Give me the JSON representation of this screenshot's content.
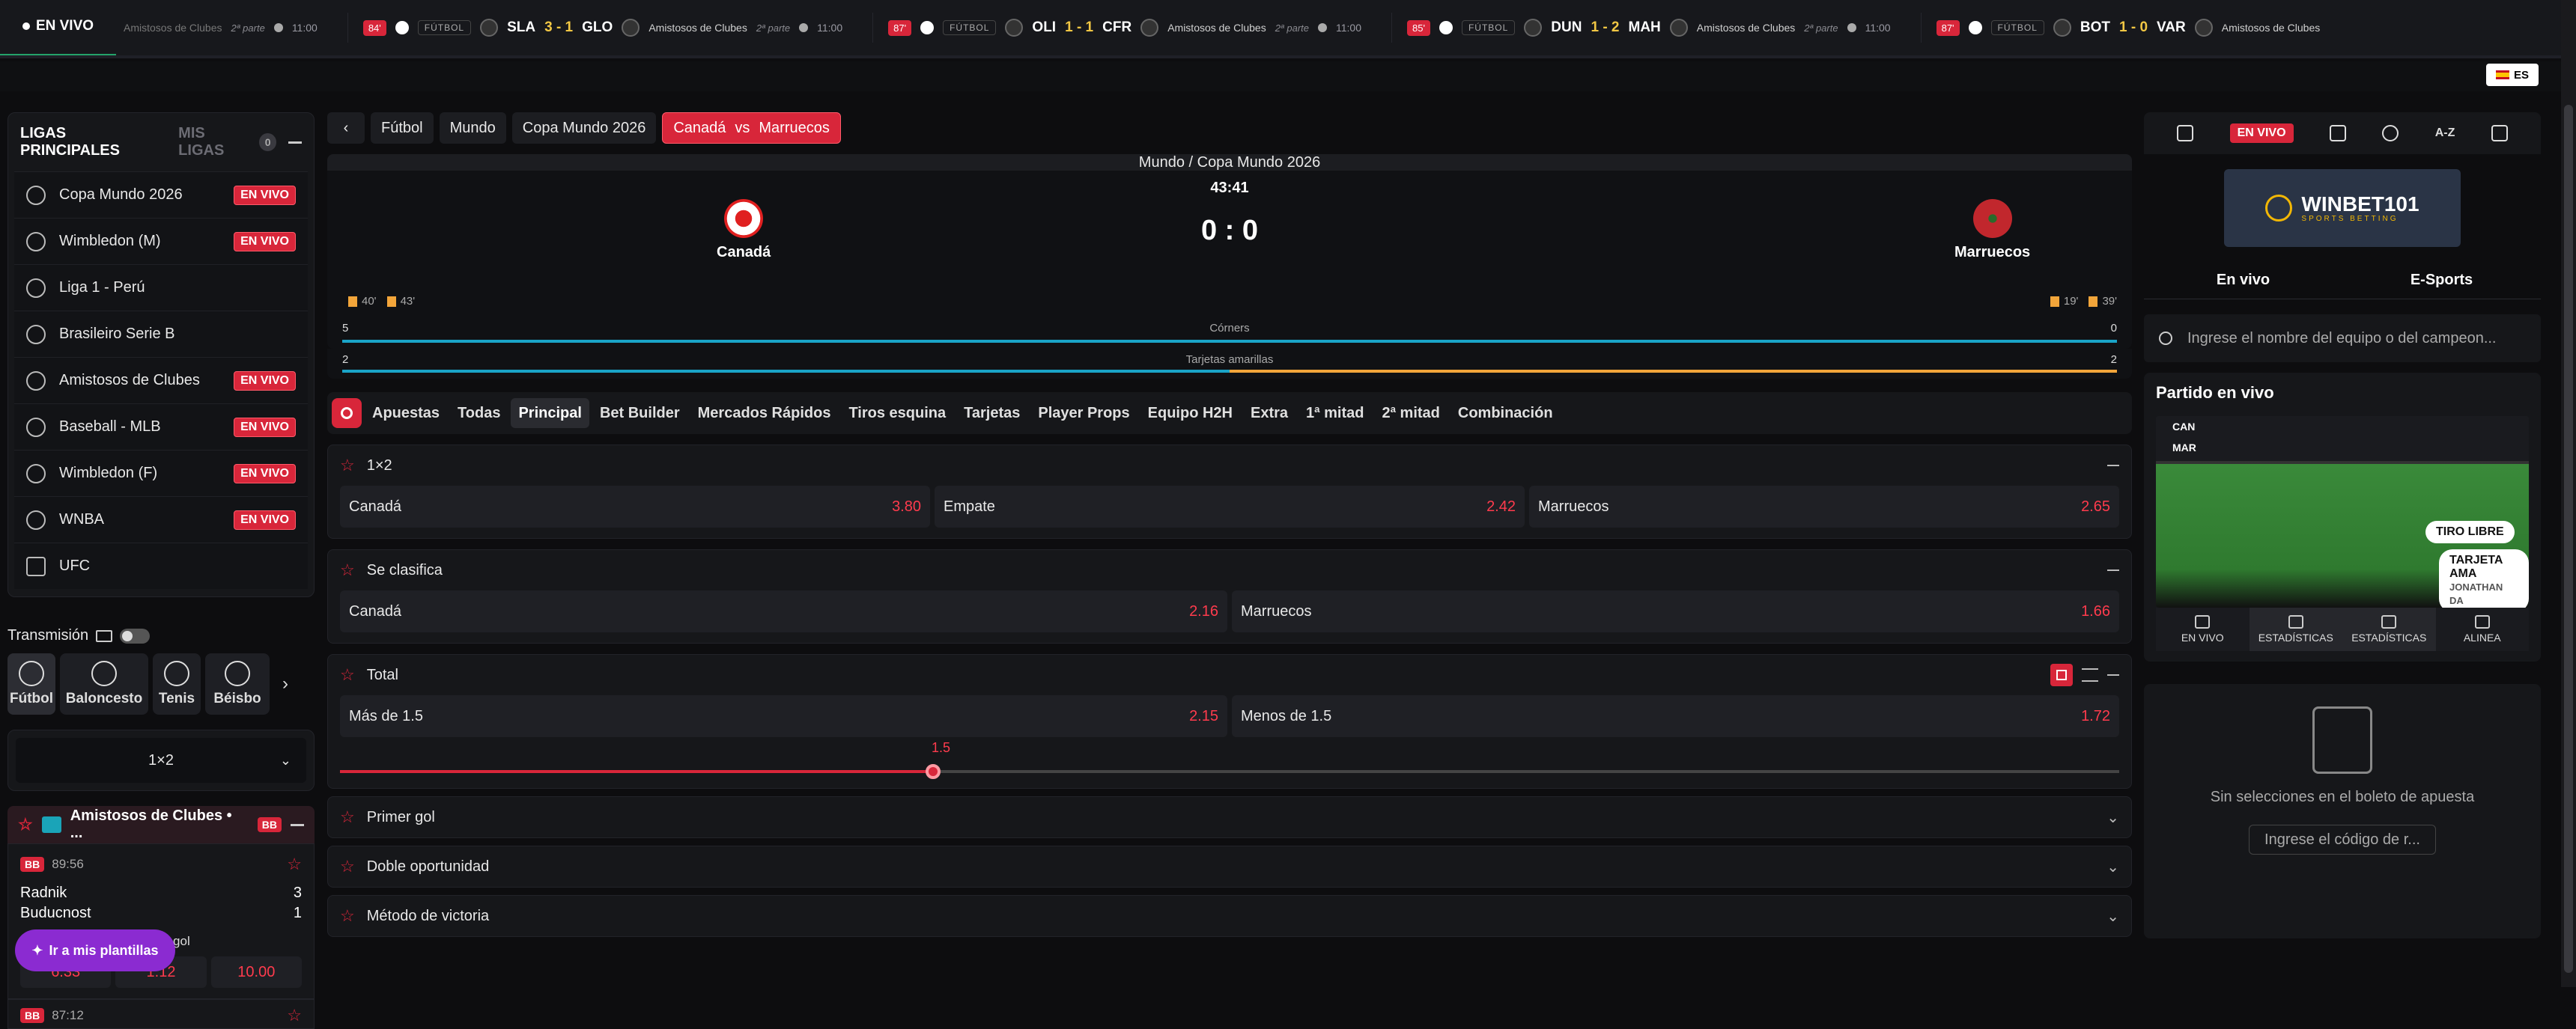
{
  "ticker": {
    "live_label": "EN VIVO",
    "items": [
      {
        "min": "",
        "sport": "",
        "home": "",
        "score": "",
        "away": "",
        "comp": "Amistosos de Clubes",
        "phase": "2ª parte",
        "time": "11:00"
      },
      {
        "min": "84'",
        "sport": "FÚTBOL",
        "home": "SLA",
        "score": "3 - 1",
        "away": "GLO",
        "comp": "Amistosos de Clubes",
        "phase": "2ª parte",
        "time": "11:00"
      },
      {
        "min": "87'",
        "sport": "FÚTBOL",
        "home": "OLI",
        "score": "1 - 1",
        "away": "CFR",
        "comp": "Amistosos de Clubes",
        "phase": "2ª parte",
        "time": "11:00"
      },
      {
        "min": "85'",
        "sport": "FÚTBOL",
        "home": "DUN",
        "score": "1 - 2",
        "away": "MAH",
        "comp": "Amistosos de Clubes",
        "phase": "2ª parte",
        "time": "11:00"
      },
      {
        "min": "87'",
        "sport": "FÚTBOL",
        "home": "BOT",
        "score": "1 - 0",
        "away": "VAR",
        "comp": "Amistosos de Clubes",
        "phase": "",
        "time": ""
      }
    ]
  },
  "lang": "ES",
  "leagues": {
    "title": "LIGAS PRINCIPALES",
    "my_label": "MIS LIGAS",
    "my_count": "0",
    "live_label": "EN VIVO",
    "items": [
      {
        "name": "Copa Mundo 2026",
        "live": true
      },
      {
        "name": "Wimbledon (M)",
        "live": true
      },
      {
        "name": "Liga 1 - Perú",
        "live": false
      },
      {
        "name": "Brasileiro Serie B",
        "live": false
      },
      {
        "name": "Amistosos de Clubes",
        "live": true
      },
      {
        "name": "Baseball - MLB",
        "live": true
      },
      {
        "name": "Wimbledon (F)",
        "live": true
      },
      {
        "name": "WNBA",
        "live": true
      },
      {
        "name": "UFC",
        "live": false
      }
    ]
  },
  "transmission": "Transmisión",
  "sports": [
    "Fútbol",
    "Baloncesto",
    "Tenis",
    "Béisbo"
  ],
  "market_select": "1×2",
  "club": {
    "title": "Amistosos de Clubes • ...",
    "bb": "BB",
    "match": {
      "time": "89:56",
      "home": "Radnik",
      "away": "Buducnost",
      "home_score": "3",
      "away_score": "1",
      "market": "Quinto gol",
      "odds": [
        "6.33",
        "1.12",
        "10.00"
      ]
    },
    "next_time": "87:12"
  },
  "templates_button": "Ir a mis plantillas",
  "breadcrumbs": [
    "Fútbol",
    "Mundo",
    "Copa Mundo 2026"
  ],
  "active_crumb": {
    "home": "Canadá",
    "vs": "vs",
    "away": "Marruecos"
  },
  "scoreboard": {
    "competition": "Mundo / Copa Mundo 2026",
    "clock": "43:41",
    "score": "0 : 0",
    "home": "Canadá",
    "away": "Marruecos",
    "home_cards": [
      "40'",
      "43'"
    ],
    "away_cards": [
      "19'",
      "39'"
    ],
    "corners": {
      "label": "Córners",
      "home": "5",
      "away": "0"
    },
    "yellow": {
      "label": "Tarjetas amarillas",
      "home": "2",
      "away": "2"
    }
  },
  "tabs": [
    "Apuestas",
    "Todas",
    "Principal",
    "Bet Builder",
    "Mercados Rápidos",
    "Tiros esquina",
    "Tarjetas",
    "Player Props",
    "Equipo H2H",
    "Extra",
    "1ª mitad",
    "2ª mitad",
    "Combinación"
  ],
  "markets": {
    "m1x2": {
      "title": "1×2",
      "odds": [
        {
          "label": "Canadá",
          "value": "3.80"
        },
        {
          "label": "Empate",
          "value": "2.42"
        },
        {
          "label": "Marruecos",
          "value": "2.65"
        }
      ]
    },
    "clasifica": {
      "title": "Se clasifica",
      "odds": [
        {
          "label": "Canadá",
          "value": "2.16"
        },
        {
          "label": "Marruecos",
          "value": "1.66"
        }
      ]
    },
    "total": {
      "title": "Total",
      "odds": [
        {
          "label": "Más de 1.5",
          "value": "2.15"
        },
        {
          "label": "Menos de 1.5",
          "value": "1.72"
        }
      ],
      "slider_value": "1.5"
    },
    "collapsed": [
      "Primer gol",
      "Doble oportunidad",
      "Método de victoria"
    ]
  },
  "right": {
    "live_label": "EN VIVO",
    "az": "A-Z",
    "logo_name": "WINBET101",
    "logo_sub": "SPORTS BETTING",
    "tabs": [
      "En vivo",
      "E-Sports"
    ],
    "search_placeholder": "Ingrese el nombre del equipo o del campeon...",
    "live_title": "Partido en vivo",
    "field": {
      "home": "CAN",
      "away": "MAR",
      "event1": "TIRO LIBRE",
      "event2": "TARJETA AMA",
      "player": "JONATHAN DA"
    },
    "video_tabs": [
      "EN VIVO",
      "ESTADÍSTICAS",
      "ESTADÍSTICAS",
      "ALINEA"
    ],
    "slip_empty": "Sin selecciones en el boleto de apuesta",
    "code_placeholder": "Ingrese el código de r..."
  }
}
